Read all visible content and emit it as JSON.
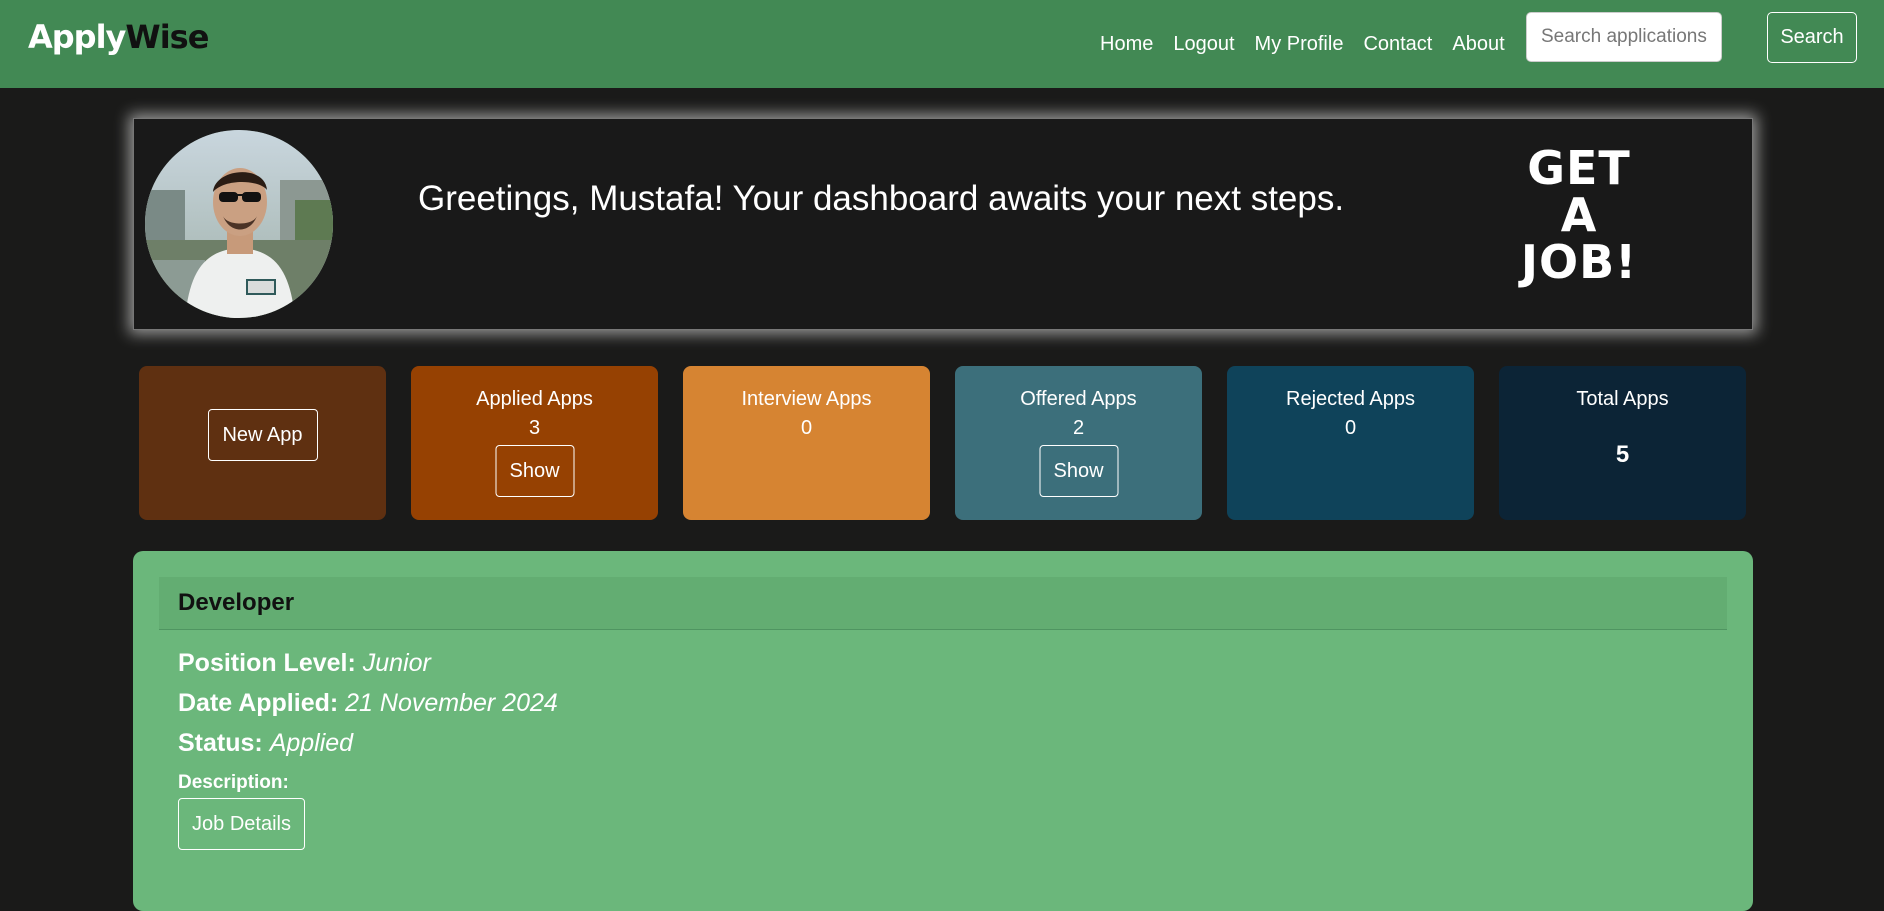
{
  "navbar": {
    "brand_part1": "Apply",
    "brand_part2": "Wise",
    "links": [
      "Home",
      "Logout",
      "My Profile",
      "Contact",
      "About"
    ],
    "search_placeholder": "Search applications",
    "search_label": "Search"
  },
  "banner": {
    "greeting": "Greetings, Mustafa! Your dashboard awaits your next steps.",
    "slogan_lines": [
      "GET",
      "A",
      "JOB!"
    ]
  },
  "cards": {
    "new_app": {
      "label": "New App",
      "color": "#5f3011"
    },
    "applied": {
      "title": "Applied Apps",
      "count": "3",
      "button": "Show",
      "color": "#964102"
    },
    "interview": {
      "title": "Interview Apps",
      "count": "0",
      "color": "#d68432"
    },
    "offered": {
      "title": "Offered Apps",
      "count": "2",
      "button": "Show",
      "color": "#3c6f7b"
    },
    "rejected": {
      "title": "Rejected Apps",
      "count": "0",
      "color": "#0f435a"
    },
    "total": {
      "title": "Total Apps",
      "count": "5",
      "color": "#0c2436"
    }
  },
  "application": {
    "title": "Developer",
    "position_label": "Position Level:",
    "position_value": "Junior",
    "date_label": "Date Applied:",
    "date_value": "21 November 2024",
    "status_label": "Status:",
    "status_value": "Applied",
    "description_label": "Description:",
    "details_button": "Job Details"
  }
}
